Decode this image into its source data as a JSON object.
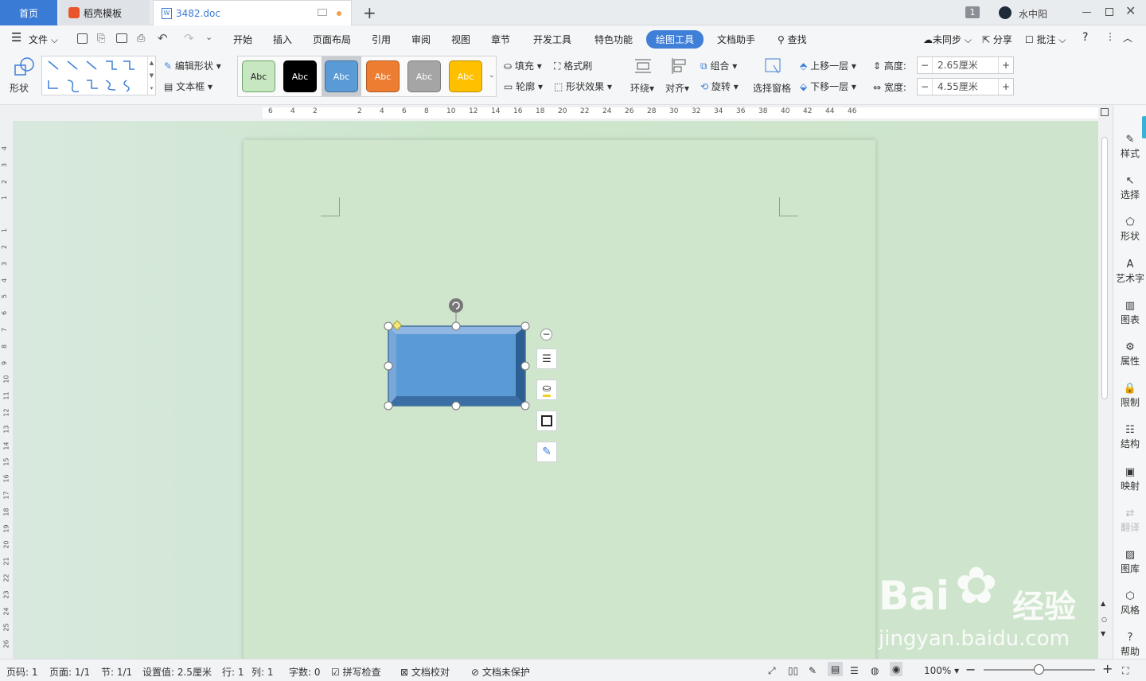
{
  "tabs": {
    "home": "首页",
    "template": "稻壳模板",
    "doc": "3482.doc",
    "add": "+"
  },
  "titlebar": {
    "badge": "1",
    "user": "水中阳"
  },
  "menu": {
    "file": "文件",
    "items": [
      "开始",
      "插入",
      "页面布局",
      "引用",
      "审阅",
      "视图",
      "章节",
      "开发工具",
      "特色功能",
      "绘图工具",
      "文档助手"
    ],
    "search": "查找",
    "sync": "未同步",
    "share": "分享",
    "review": "批注",
    "help": "?"
  },
  "ribbon": {
    "shapes_label": "形状",
    "edit_shape": "编辑形状",
    "textbox": "文本框",
    "swatches": [
      {
        "label": "Abc",
        "bg": "#c7e7c1",
        "fg": "#222222",
        "border": "#6aa56a"
      },
      {
        "label": "Abc",
        "bg": "#000000",
        "fg": "#ffffff",
        "border": "#000000"
      },
      {
        "label": "Abc",
        "bg": "#5b9bd5",
        "fg": "#ffffff",
        "border": "#41719c"
      },
      {
        "label": "Abc",
        "bg": "#ed7d31",
        "fg": "#ffffff",
        "border": "#ae5a21"
      },
      {
        "label": "Abc",
        "bg": "#a5a5a5",
        "fg": "#ffffff",
        "border": "#7c7c7c"
      },
      {
        "label": "Abc",
        "bg": "#ffc000",
        "fg": "#ffffff",
        "border": "#bc8c00"
      }
    ],
    "fill": "填充",
    "format_painter": "格式刷",
    "outline": "轮廓",
    "shape_effect": "形状效果",
    "wrap": "环绕",
    "align": "对齐",
    "group": "组合",
    "rotate": "旋转",
    "select_pane": "选择窗格",
    "bring_forward": "上移一层",
    "send_backward": "下移一层",
    "height_label": "高度:",
    "height_value": "2.65厘米",
    "width_label": "宽度:",
    "width_value": "4.55厘米"
  },
  "hruler_ticks": [
    "6",
    "4",
    "2",
    "2",
    "4",
    "6",
    "8",
    "10",
    "12",
    "14",
    "16",
    "18",
    "20",
    "22",
    "24",
    "26",
    "28",
    "30",
    "32",
    "34",
    "36",
    "38",
    "40",
    "42",
    "44",
    "46"
  ],
  "vruler_ticks": [
    "4",
    "3",
    "2",
    "1",
    "1",
    "2",
    "3",
    "4",
    "5",
    "6",
    "7",
    "8",
    "9",
    "10",
    "11",
    "12",
    "13",
    "14",
    "15",
    "16",
    "17",
    "18",
    "19",
    "20",
    "21",
    "22",
    "23",
    "24",
    "25",
    "26"
  ],
  "sidebar": [
    "样式",
    "选择",
    "形状",
    "艺术字",
    "图表",
    "属性",
    "限制",
    "结构",
    "映射",
    "翻译",
    "图库",
    "风格",
    "帮助"
  ],
  "status": {
    "page": "页码: 1",
    "pages": "页面: 1/1",
    "section": "节: 1/1",
    "setting": "设置值: 2.5厘米",
    "row": "行: 1",
    "col": "列: 1",
    "words": "字数: 0",
    "spell": "拼写检查",
    "proof": "文档校对",
    "protect": "文档未保护",
    "zoom": "100%"
  },
  "watermark": {
    "brand": "Bai",
    "brand2": "经验",
    "url": "jingyan.baidu.com"
  },
  "colors": {
    "accent": "#3f7fd8",
    "shape_fill": "#5b9bd5",
    "shape_dark": "#2e5f93",
    "canvas": "#cfe6cc"
  }
}
